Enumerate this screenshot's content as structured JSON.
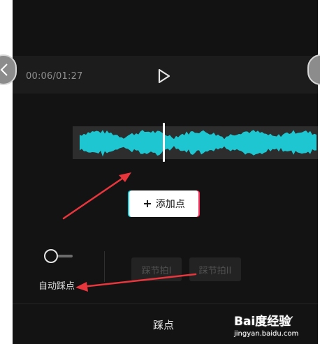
{
  "player": {
    "time": "00:06/01:27",
    "play_icon": "play-icon"
  },
  "waveform": {
    "color": "#1ec6d2",
    "playhead_position": 0.38
  },
  "add_point": {
    "label": "添加点",
    "plus": "+"
  },
  "auto_beat": {
    "label": "自动踩点",
    "toggle_on": false
  },
  "beat_buttons": [
    "踩节拍I",
    "踩节拍II"
  ],
  "bottom_bar": {
    "title": "踩点",
    "confirm_icon": "checkmark-icon"
  },
  "annotations": {
    "arrow_color": "#e8363d"
  },
  "watermark": {
    "logo": "Bai度经验",
    "url": "jingyan.baidu.com"
  }
}
